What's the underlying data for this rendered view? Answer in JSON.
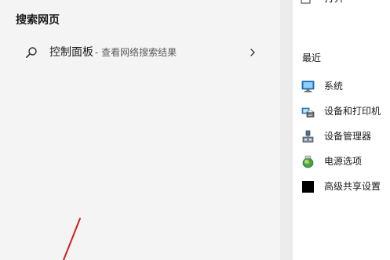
{
  "search_web": {
    "section_title": "搜索网页",
    "result": {
      "query": "控制面板",
      "suffix": "- 查看网络搜索结果",
      "icon": "search-icon",
      "arrow_icon": "chevron-right-icon"
    }
  },
  "preview": {
    "open_label": "打开",
    "recent_title": "最近",
    "recent_items": [
      {
        "label": "系统",
        "icon": "system-monitor-icon"
      },
      {
        "label": "设备和打印机",
        "icon": "devices-printers-icon"
      },
      {
        "label": "设备管理器",
        "icon": "device-manager-icon"
      },
      {
        "label": "电源选项",
        "icon": "power-options-icon"
      },
      {
        "label": "高级共享设置",
        "icon": "advanced-sharing-icon"
      }
    ]
  },
  "colors": {
    "left_background": "#f4f4f4",
    "right_background": "#ffffff",
    "annotation_red": "#cc1f1f"
  }
}
